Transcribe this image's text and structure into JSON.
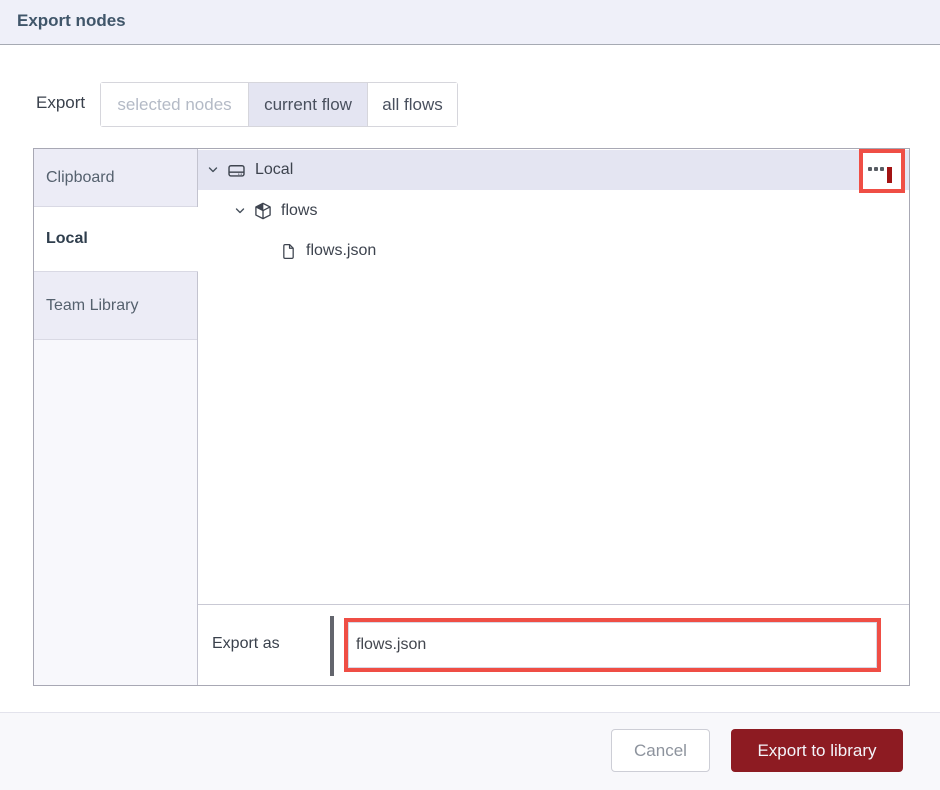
{
  "dialog": {
    "title": "Export nodes",
    "scope": {
      "label": "Export",
      "options": [
        {
          "label": "selected nodes",
          "state": "disabled"
        },
        {
          "label": "current flow",
          "state": "selected"
        },
        {
          "label": "all flows",
          "state": "normal"
        }
      ]
    },
    "library": {
      "tabs": [
        {
          "label": "Clipboard",
          "selected": false
        },
        {
          "label": "Local",
          "selected": true
        },
        {
          "label": "Team Library",
          "selected": false
        }
      ],
      "tree": [
        {
          "label": "Local",
          "icon": "hard-drive-icon",
          "level": 0,
          "expanded": true,
          "selected": true
        },
        {
          "label": "flows",
          "icon": "package-icon",
          "level": 1,
          "expanded": true
        },
        {
          "label": "flows.json",
          "icon": "file-icon",
          "level": 2
        }
      ],
      "menu_button": {
        "icon": "ellipsis-icon",
        "highlighted": true
      }
    },
    "filename": {
      "label": "Export as",
      "value": "flows.json",
      "highlighted": true
    },
    "footer": {
      "cancel": "Cancel",
      "confirm": "Export to library"
    }
  },
  "colors": {
    "annotation_red": "#ef4e45",
    "primary_button": "#8d1b22",
    "selection_lavender": "#e4e5f2",
    "header_bg": "#eff0f9",
    "dark_red_indicator": "#a31313"
  }
}
